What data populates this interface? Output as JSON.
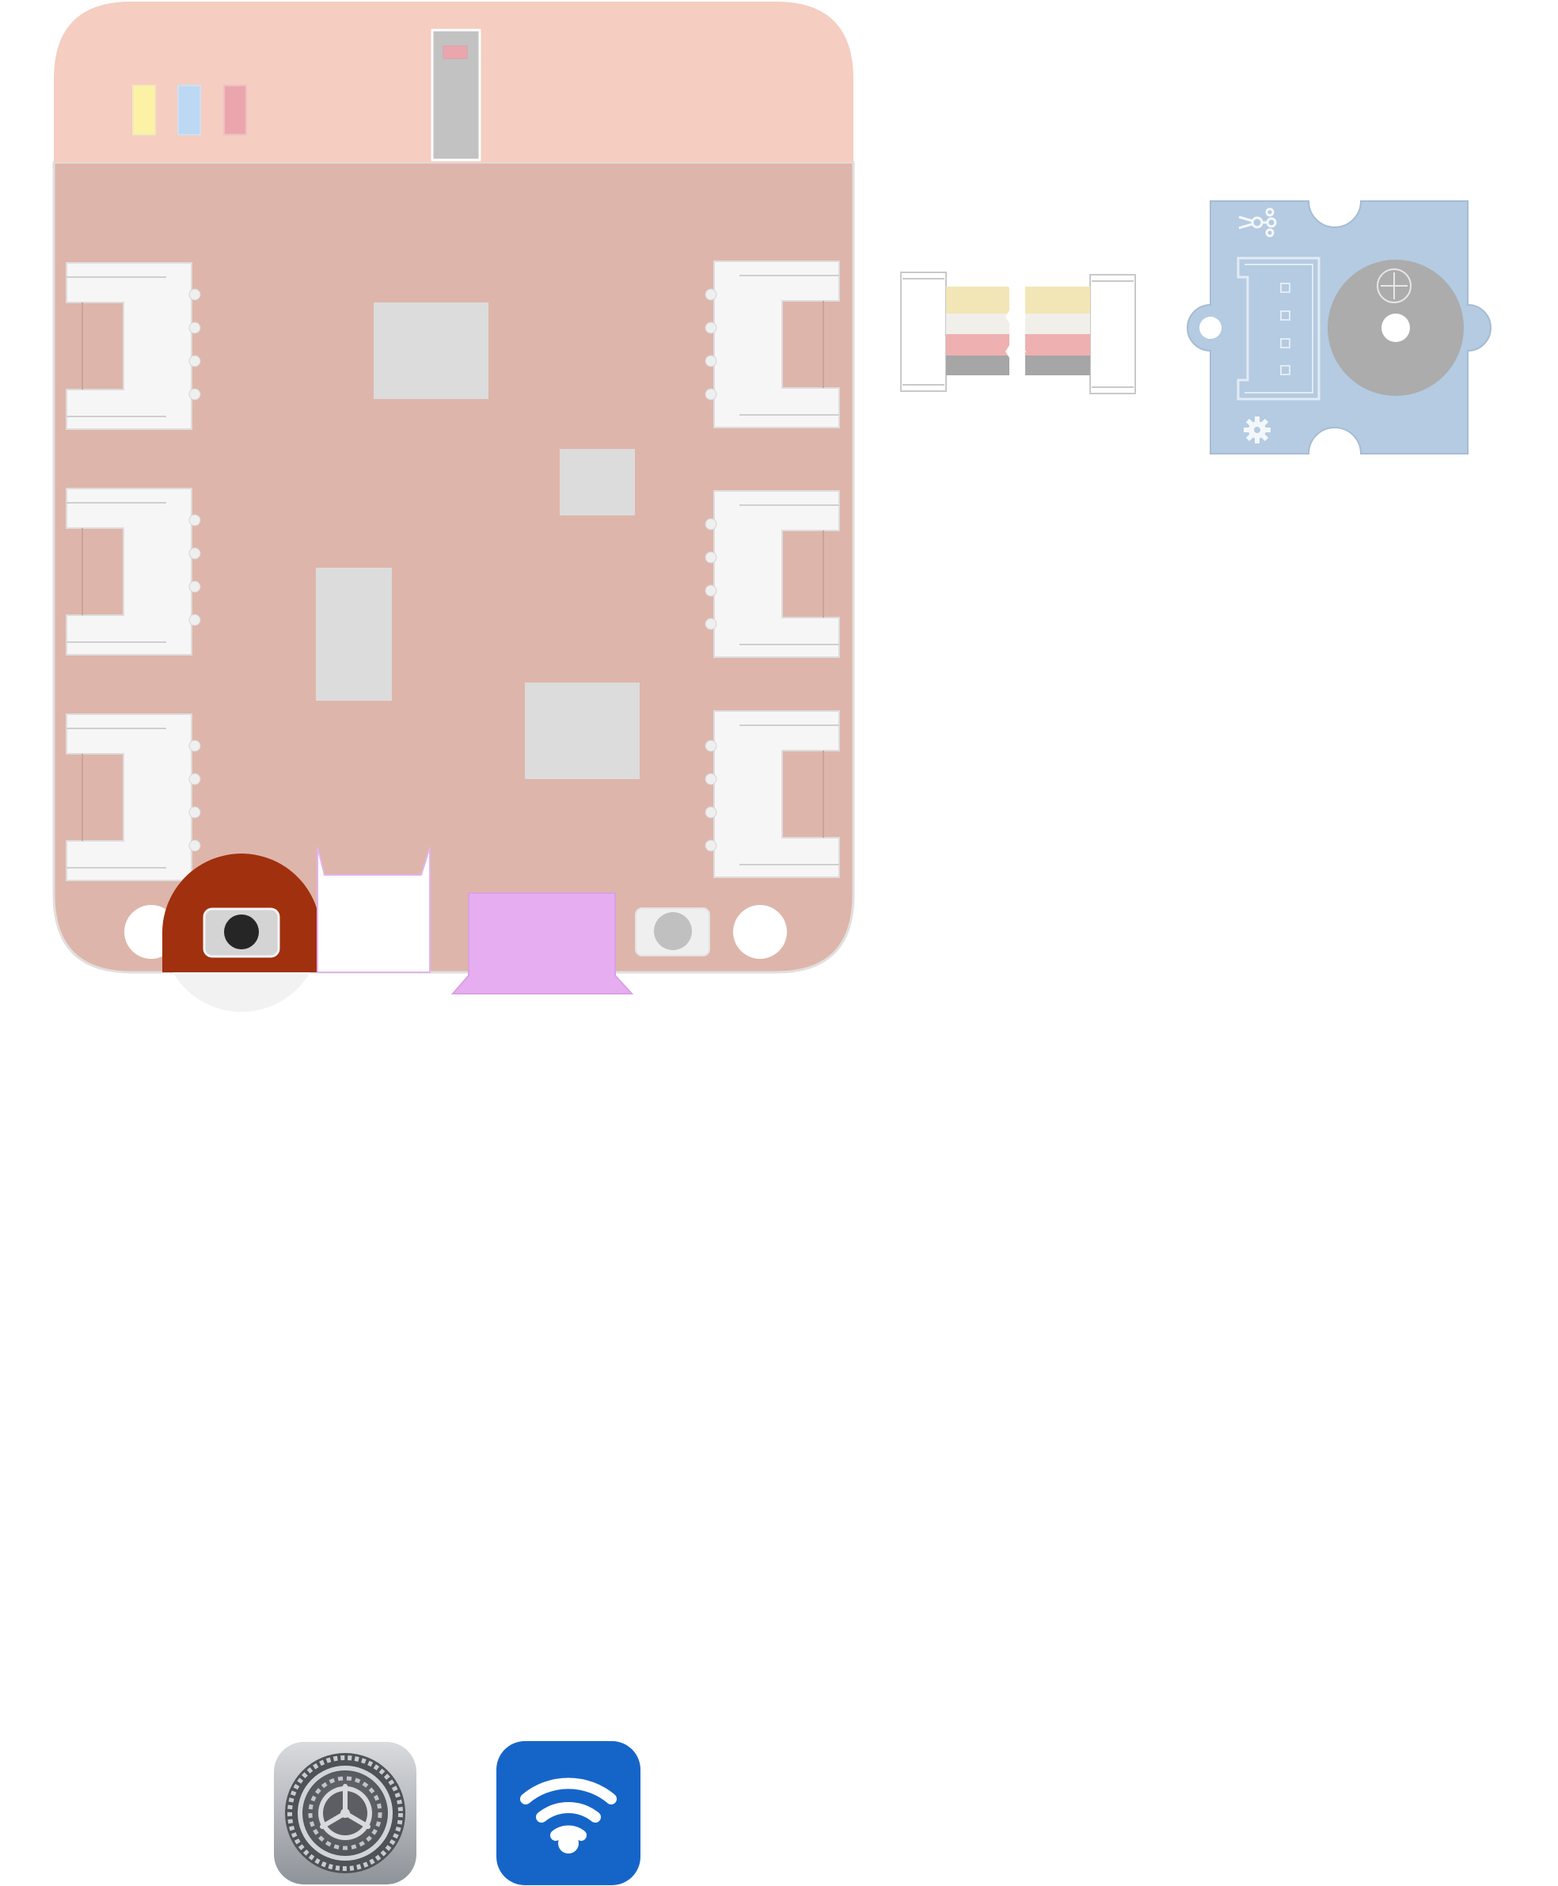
{
  "page": {
    "background": "#ffffff"
  },
  "colors": {
    "board_top": "#f5cdc1",
    "board_body": "#deb5aa",
    "board_border": "#e2dfde",
    "connector_white": "#f7f6f6",
    "chip_gray": "#dcdcdc",
    "led_yellow": "#fbf2a6",
    "led_blue": "#bcd8f3",
    "led_pink": "#eba6ad",
    "power_button_red": "#a1300e",
    "usb_magenta": "#e6aef0",
    "buzzer_module_blue": "#b4cbe2",
    "buzzer_gray": "#acacac",
    "cable_yellow": "#f2e6b6",
    "cable_white": "#f1efea",
    "cable_red": "#efb0b1",
    "cable_black": "#a6a6a6",
    "settings_icon_gray": "#8e9399",
    "wifi_icon_blue": "#1565c9"
  },
  "icons": {
    "settings": "settings-gear-icon",
    "wifi": "wifi-icon",
    "module_signal": "signal-node-icon",
    "module_gear": "gear-icon",
    "buzzer_plus": "plus-icon"
  },
  "captions": {
    "line1": "",
    "line2": "",
    "line3": ""
  }
}
